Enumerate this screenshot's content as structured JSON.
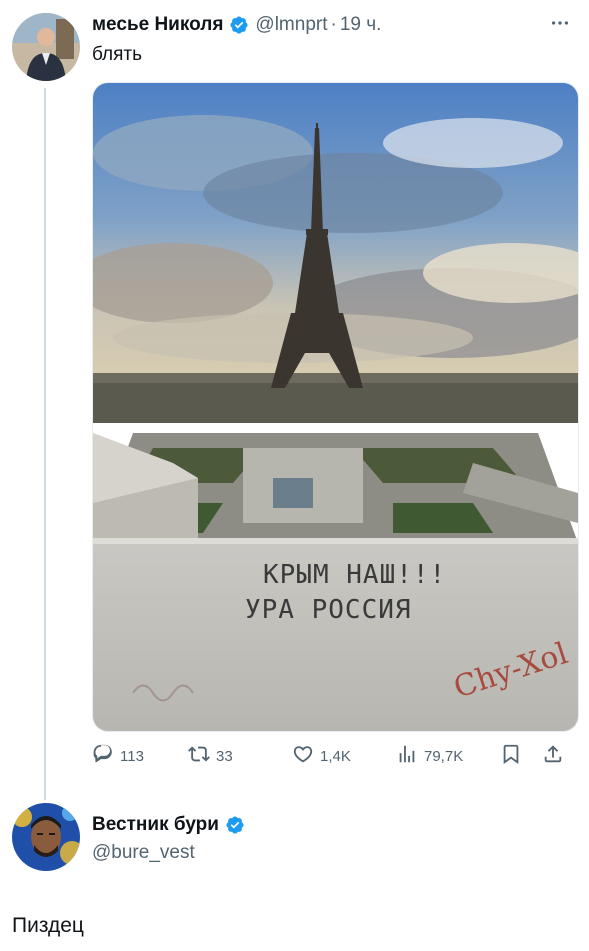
{
  "tweet1": {
    "name": "месье Николя",
    "handle": "@lmnprt",
    "dot": "·",
    "time": "19 ч.",
    "text": "блять",
    "image_text_line1": "КРЫМ НАШ!!!",
    "image_text_line2": "УРА РОССИЯ",
    "image_scribble": "Chy-Xol",
    "actions": {
      "replies": "113",
      "reposts": "33",
      "likes": "1,4K",
      "views": "79,7K"
    }
  },
  "tweet2": {
    "name": "Вестник бури",
    "handle": "@bure_vest",
    "text": "Пиздец"
  },
  "icons": {
    "verified": "verified-badge-icon",
    "more": "more-icon",
    "reply": "reply-icon",
    "repost": "repost-icon",
    "like": "heart-icon",
    "views": "views-icon",
    "bookmark": "bookmark-icon",
    "share": "share-icon"
  },
  "colors": {
    "accent": "#1d9bf0",
    "secondary_text": "#536471",
    "thread_line": "#cfd9de"
  }
}
